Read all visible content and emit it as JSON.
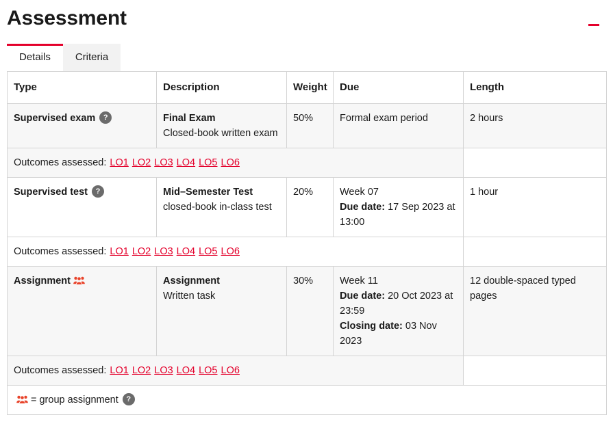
{
  "header": {
    "title": "Assessment",
    "collapse_icon": "minus-icon"
  },
  "tabs": [
    {
      "label": "Details",
      "active": true
    },
    {
      "label": "Criteria",
      "active": false
    }
  ],
  "table": {
    "columns": [
      "Type",
      "Description",
      "Weight",
      "Due",
      "Length"
    ],
    "outcomes_label": "Outcomes assessed:",
    "outcomes_links": [
      "LO1",
      "LO2",
      "LO3",
      "LO4",
      "LO5",
      "LO6"
    ],
    "rows": [
      {
        "type": "Supervised exam",
        "type_icon": "help-icon",
        "type_icon_label": "?",
        "description_title": "Final Exam",
        "description_sub": "Closed-book written exam",
        "weight": "50%",
        "due_lines": [
          {
            "label": "",
            "value": "Formal exam period"
          }
        ],
        "length": "2 hours"
      },
      {
        "type": "Supervised test",
        "type_icon": "help-icon",
        "type_icon_label": "?",
        "description_title": "Mid–Semester Test",
        "description_sub": "closed-book in-class test",
        "weight": "20%",
        "due_lines": [
          {
            "label": "",
            "value": "Week 07"
          },
          {
            "label": "Due date:",
            "value": "17 Sep 2023 at 13:00"
          }
        ],
        "length": "1 hour"
      },
      {
        "type": "Assignment",
        "type_icon": "group-assignment-icon",
        "type_icon_label": "",
        "description_title": "Assignment",
        "description_sub": "Written task",
        "weight": "30%",
        "due_lines": [
          {
            "label": "",
            "value": "Week 11"
          },
          {
            "label": "Due date:",
            "value": "20 Oct 2023 at 23:59"
          },
          {
            "label": "Closing date:",
            "value": "03 Nov 2023"
          }
        ],
        "length": "12 double-spaced typed pages"
      }
    ],
    "legend": {
      "icon": "group-assignment-icon",
      "text": "= group assignment",
      "help_label": "?"
    }
  },
  "colors": {
    "accent": "#e4002b",
    "link": "#e4002b",
    "row_shade": "#f7f7f7",
    "border": "#d4d4d4",
    "help_bg": "#6b6b6b",
    "text": "#1a1a1a"
  }
}
